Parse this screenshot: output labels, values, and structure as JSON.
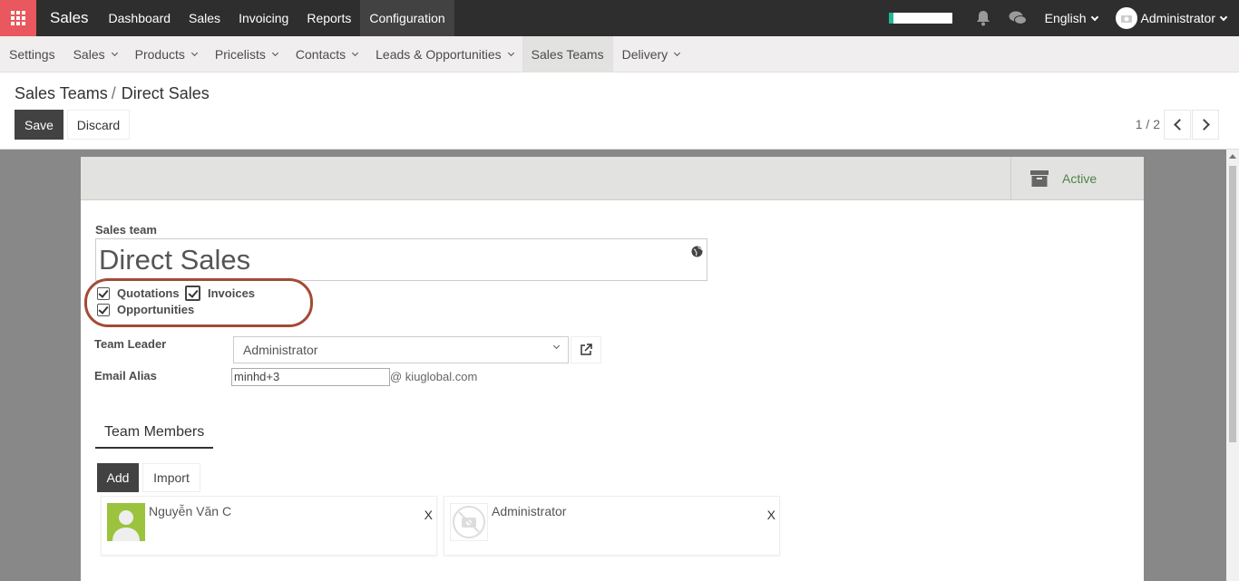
{
  "app": {
    "brand": "Sales"
  },
  "topmenu": [
    "Dashboard",
    "Sales",
    "Invoicing",
    "Reports",
    "Configuration"
  ],
  "systray": {
    "progress_percent": 8,
    "progress_color": "#21b799",
    "language": "English",
    "user": "Administrator"
  },
  "submenu": [
    {
      "label": "Settings",
      "dropdown": false
    },
    {
      "label": "Sales",
      "dropdown": true
    },
    {
      "label": "Products",
      "dropdown": true
    },
    {
      "label": "Pricelists",
      "dropdown": true
    },
    {
      "label": "Contacts",
      "dropdown": true
    },
    {
      "label": "Leads & Opportunities",
      "dropdown": true
    },
    {
      "label": "Sales Teams",
      "dropdown": false
    },
    {
      "label": "Delivery",
      "dropdown": true
    }
  ],
  "breadcrumb": {
    "parent": "Sales Teams",
    "separator": "/",
    "current": "Direct Sales"
  },
  "buttons": {
    "save": "Save",
    "discard": "Discard",
    "add": "Add",
    "import": "Import"
  },
  "pager": {
    "text": "1 / 2"
  },
  "status": {
    "active_label": "Active",
    "active_color": "#4e8349"
  },
  "form": {
    "sales_team_label": "Sales team",
    "sales_team_value": "Direct Sales",
    "checkboxes": {
      "quotations": "Quotations",
      "invoices": "Invoices",
      "opportunities": "Opportunities"
    },
    "team_leader_label": "Team Leader",
    "team_leader_value": "Administrator",
    "email_alias_label": "Email Alias",
    "email_alias_value": "minhd+3",
    "email_alias_domain": "@ kiuglobal.com"
  },
  "tabs": {
    "team_members": "Team Members"
  },
  "members": [
    {
      "name": "Nguyễn Văn C",
      "remove": "X"
    },
    {
      "name": "Administrator",
      "remove": "X"
    }
  ],
  "colors": {
    "topbar": "#2e2e2e",
    "apps": "#e8585e",
    "annotation": "#a34b34"
  }
}
